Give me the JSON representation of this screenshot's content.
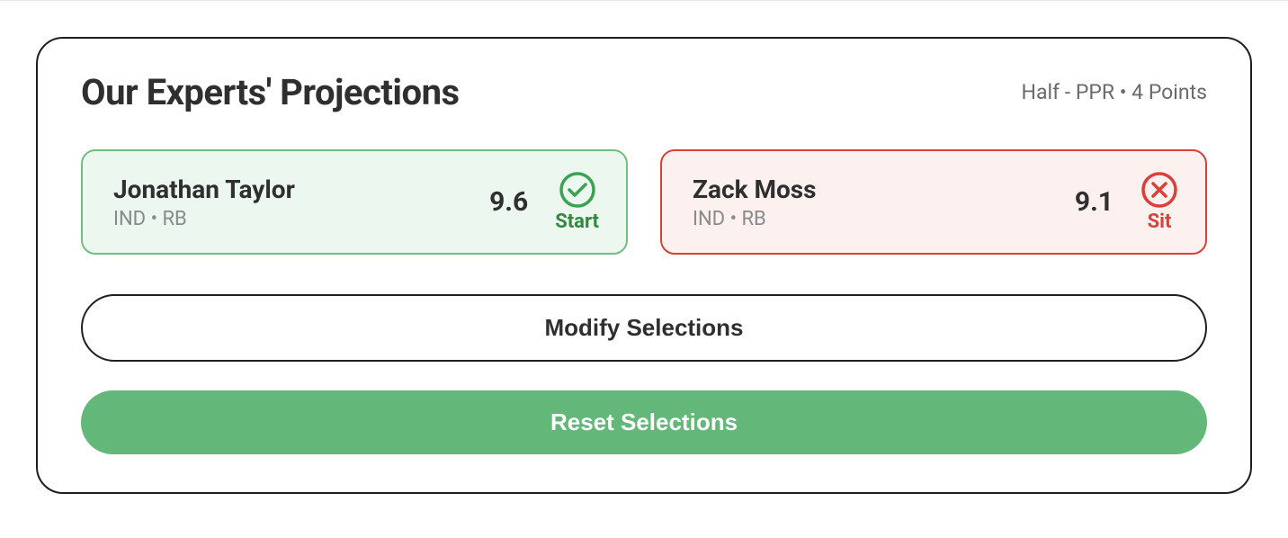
{
  "header": {
    "title": "Our Experts' Projections",
    "scoring": "Half - PPR  •  4 Points"
  },
  "players": [
    {
      "name": "Jonathan Taylor",
      "meta": "IND  •  RB",
      "projection": "9.6",
      "recommendation": "Start"
    },
    {
      "name": "Zack Moss",
      "meta": "IND  •  RB",
      "projection": "9.1",
      "recommendation": "Sit"
    }
  ],
  "buttons": {
    "modify": "Modify Selections",
    "reset": "Reset Selections"
  },
  "colors": {
    "start_border": "#6fbf7f",
    "start_bg": "#ecf8ef",
    "start_text": "#2f8a3f",
    "sit_border": "#d9403a",
    "sit_bg": "#fdf1f0",
    "sit_text": "#d9403a",
    "reset_bg": "#63b779"
  }
}
